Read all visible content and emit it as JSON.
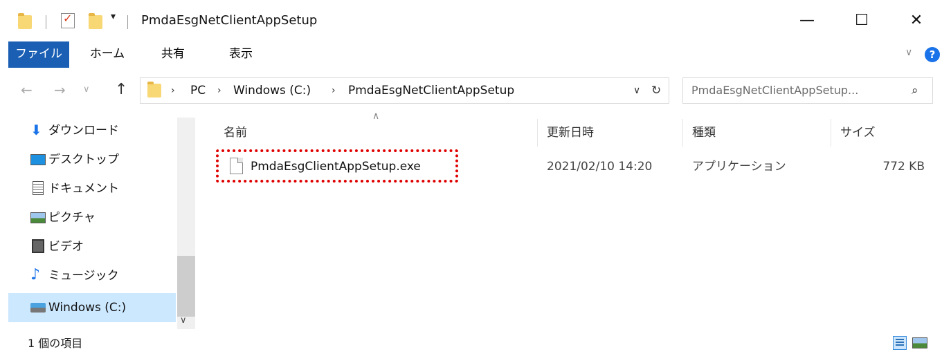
{
  "window": {
    "title": "PmdaEsgNetClientAppSetup",
    "controls": {
      "minimize": "—",
      "maximize": "☐",
      "close": "✕"
    }
  },
  "ribbon": {
    "tabs": [
      "ファイル",
      "ホーム",
      "共有",
      "表示"
    ],
    "active_tab": "ファイル",
    "help_icon": "?"
  },
  "addressbar": {
    "crumbs": [
      "PC",
      "Windows (C:)",
      "PmdaEsgNetClientAppSetup"
    ],
    "dropdown_icon": "chevron-down-icon",
    "refresh_icon": "refresh-icon"
  },
  "search": {
    "placeholder": "PmdaEsgNetClientAppSetup..."
  },
  "nav_pane": {
    "items": [
      {
        "label": "ダウンロード",
        "icon": "download-icon"
      },
      {
        "label": "デスクトップ",
        "icon": "desktop-icon"
      },
      {
        "label": "ドキュメント",
        "icon": "document-icon"
      },
      {
        "label": "ピクチャ",
        "icon": "pictures-icon"
      },
      {
        "label": "ビデオ",
        "icon": "video-icon"
      },
      {
        "label": "ミュージック",
        "icon": "music-icon"
      },
      {
        "label": "Windows (C:)",
        "icon": "drive-icon"
      }
    ],
    "selected": "Windows (C:)"
  },
  "file_list": {
    "columns": [
      "名前",
      "更新日時",
      "種類",
      "サイズ"
    ],
    "rows": [
      {
        "name": "PmdaEsgClientAppSetup.exe",
        "modified": "2021/02/10 14:20",
        "type": "アプリケーション",
        "size": "772 KB"
      }
    ],
    "highlight_color": "#e00000"
  },
  "statusbar": {
    "count": "1 個の項目"
  },
  "colors": {
    "accent": "#1a5fb4",
    "selection": "#cce8ff"
  }
}
